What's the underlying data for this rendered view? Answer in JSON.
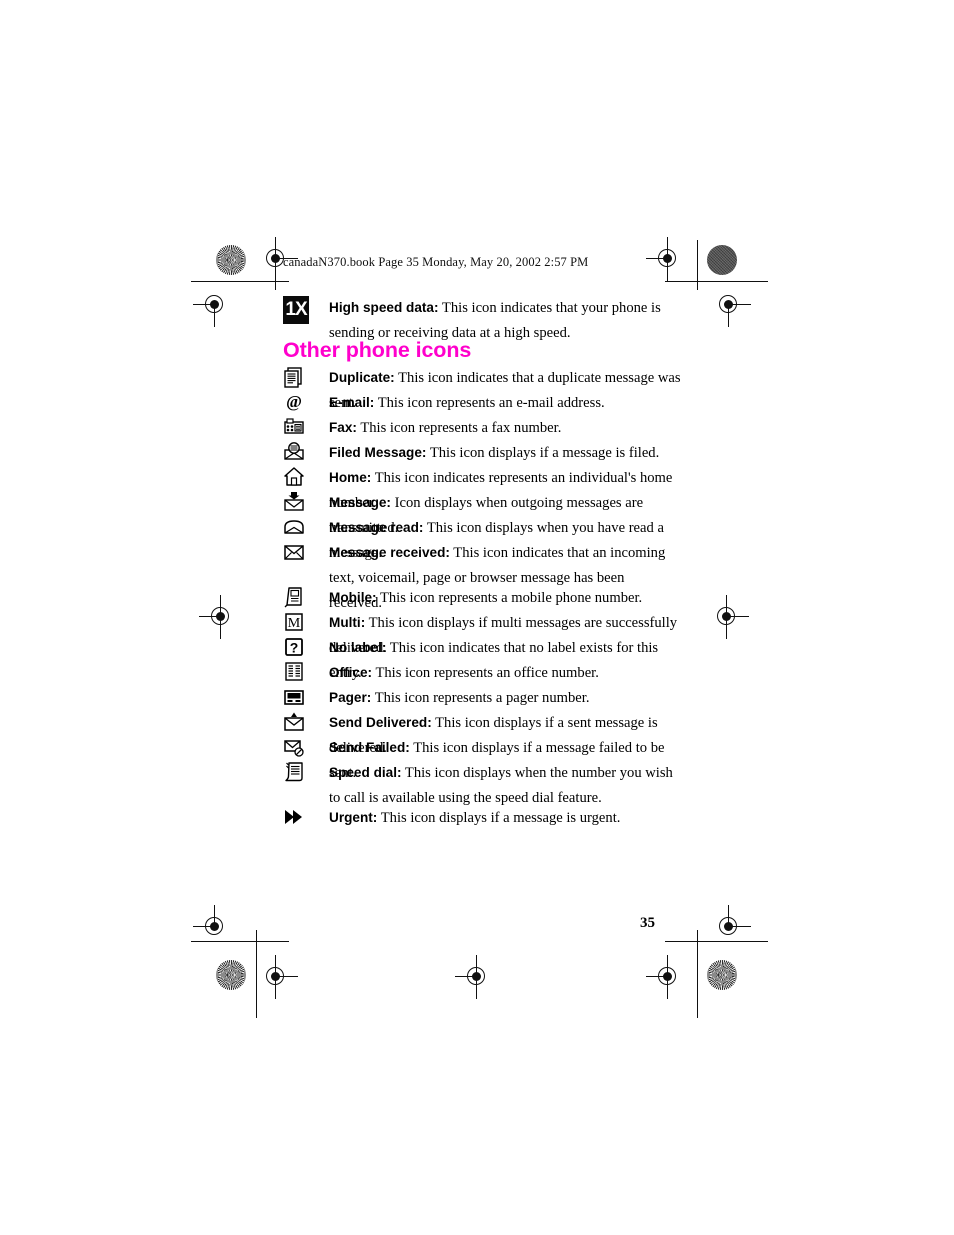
{
  "document": {
    "file_info": "canadaN370.book  Page 35  Monday, May 20, 2002  2:57 PM",
    "page_number": "35",
    "heading_color": "#FF00CC"
  },
  "intro_entry": {
    "icon": "1x-high-speed-data-icon",
    "icon_text": "1X",
    "label": "High speed data:",
    "description": "This icon indicates that your phone is sending or receiving data at a high speed."
  },
  "section": {
    "heading": "Other phone icons",
    "entries": [
      {
        "icon": "duplicate-pages-icon",
        "label": "Duplicate:",
        "description": "This icon indicates that a duplicate message was sent."
      },
      {
        "icon": "at-sign-email-icon",
        "label": "E-mail:",
        "description": "This icon represents an e-mail address."
      },
      {
        "icon": "fax-machine-icon",
        "label": "Fax:",
        "description": "This icon represents a fax number."
      },
      {
        "icon": "filed-message-envelope-icon",
        "label": "Filed Message:",
        "description": "This icon displays if a message is filed."
      },
      {
        "icon": "home-house-icon",
        "label": "Home:",
        "description": "This icon indicates represents an individual's home number."
      },
      {
        "icon": "message-sent-envelope-icon",
        "label": "Message:",
        "description": "Icon displays when outgoing messages are transmitted."
      },
      {
        "icon": "message-read-open-envelope-icon",
        "label": "Message read:",
        "description": "This icon displays when you have read a message."
      },
      {
        "icon": "message-received-envelope-icon",
        "label": "Message received:",
        "description": "This icon indicates that an incoming text, voicemail, page or browser message has been received."
      },
      {
        "icon": "mobile-phone-icon",
        "label": "Mobile:",
        "description": "This icon represents a mobile phone number."
      },
      {
        "icon": "multi-message-m-icon",
        "label": "Multi:",
        "description": "This icon displays if multi messages are successfully delivered."
      },
      {
        "icon": "no-label-question-mark-icon",
        "label": "No label:",
        "description": "This icon indicates that no label exists for this entry."
      },
      {
        "icon": "office-document-icon",
        "label": "Office:",
        "description": "This icon represents an office number."
      },
      {
        "icon": "pager-device-icon",
        "label": "Pager:",
        "description": "This icon represents a pager number."
      },
      {
        "icon": "send-delivered-envelope-icon",
        "label": "Send Delivered:",
        "description": "This icon displays if a sent message is delivered."
      },
      {
        "icon": "send-failed-envelope-icon",
        "label": "Send Failed:",
        "description": "This icon displays if a message failed to be sent."
      },
      {
        "icon": "speed-dial-list-icon",
        "label": "Speed dial:",
        "description": "This icon displays when the number you wish to call is available using the speed dial feature."
      },
      {
        "icon": "urgent-double-arrow-icon",
        "label": "Urgent:",
        "description": "This icon displays if a message is urgent."
      }
    ]
  }
}
